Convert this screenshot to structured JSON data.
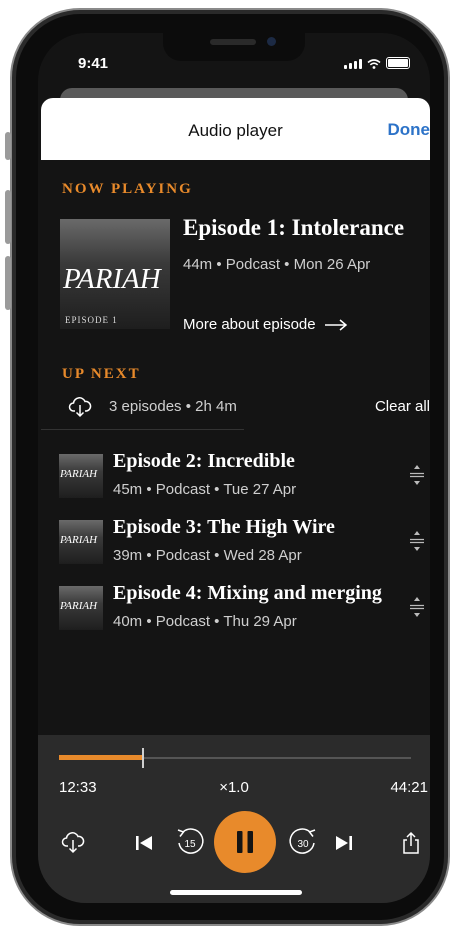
{
  "status": {
    "time": "9:41"
  },
  "sheet": {
    "title": "Audio player",
    "done_label": "Done"
  },
  "now_playing": {
    "section_label": "NOW PLAYING",
    "artwork": {
      "show_title": "PARIAH",
      "episode_tag": "EPISODE 1"
    },
    "title": "Episode 1: Intolerance",
    "duration": "44m",
    "type": "Podcast",
    "date": "Mon 26 Apr",
    "more_label": "More about episode"
  },
  "up_next": {
    "section_label": "UP NEXT",
    "summary": "3 episodes • 2h 4m",
    "clear_label": "Clear all",
    "episodes": [
      {
        "thumb_text": "PARIAH",
        "title": "Episode 2: Incredible",
        "duration": "45m",
        "type": "Podcast",
        "date": "Tue 27 Apr"
      },
      {
        "thumb_text": "PARIAH",
        "title": "Episode 3: The High Wire",
        "duration": "39m",
        "type": "Podcast",
        "date": "Wed 28 Apr"
      },
      {
        "thumb_text": "PARIAH",
        "title": "Episode 4: Mixing and merging",
        "duration": "40m",
        "type": "Podcast",
        "date": "Thu 29 Apr"
      }
    ]
  },
  "player": {
    "current_time": "12:33",
    "speed": "×1.0",
    "total_time": "44:21",
    "progress": 0.237,
    "rewind_seconds": "15",
    "forward_seconds": "30"
  },
  "colors": {
    "accent": "#e88a2b",
    "link": "#2d73c8",
    "background": "#141414",
    "player_bar": "#2b2b2b"
  }
}
